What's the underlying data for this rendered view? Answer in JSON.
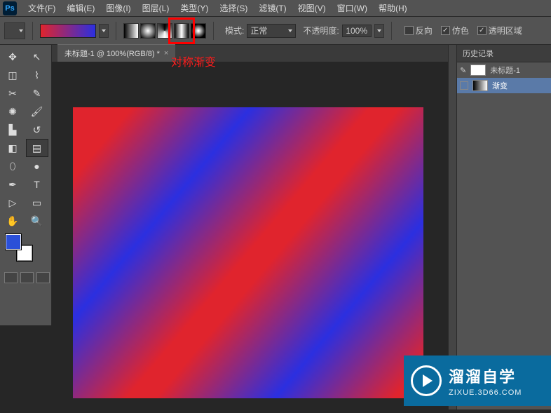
{
  "app": {
    "logo": "Ps"
  },
  "menu": {
    "items": [
      "文件(F)",
      "编辑(E)",
      "图像(I)",
      "图层(L)",
      "类型(Y)",
      "选择(S)",
      "滤镜(T)",
      "视图(V)",
      "窗口(W)",
      "帮助(H)"
    ]
  },
  "options": {
    "mode_label": "模式:",
    "mode_value": "正常",
    "opacity_label": "不透明度:",
    "opacity_value": "100%",
    "reverse_label": "反向",
    "dither_label": "仿色",
    "transparency_label": "透明区域",
    "reverse_checked": false,
    "dither_checked": true,
    "transparency_checked": true
  },
  "document": {
    "tab_title": "未标题-1 @ 100%(RGB/8) *"
  },
  "annotation": {
    "text": "对称渐变"
  },
  "panels": {
    "history": {
      "title": "历史记录",
      "snapshot": "未标题-1",
      "entries": [
        "渐变"
      ]
    }
  },
  "watermark": {
    "title": "溜溜自学",
    "url": "ZIXUE.3D66.COM"
  },
  "colors": {
    "foreground": "#2b50d8",
    "background": "#ffffff",
    "accent_highlight": "#ff0000"
  },
  "gradient_types": {
    "highlighted_index": 3,
    "names": [
      "linear",
      "radial",
      "angle",
      "reflected",
      "diamond"
    ]
  },
  "chart_data": {
    "type": "area",
    "title": "Canvas gradient (reflected/diagonal)",
    "note": "Diagonal reflected gradient stripes on canvas",
    "angle_deg": -50,
    "stops_pct": [
      0,
      25,
      47,
      70,
      95
    ],
    "stop_colors": [
      "#e0242d",
      "#2b2fe0",
      "#e0242d",
      "#2b2fe0",
      "#e0242d"
    ]
  }
}
